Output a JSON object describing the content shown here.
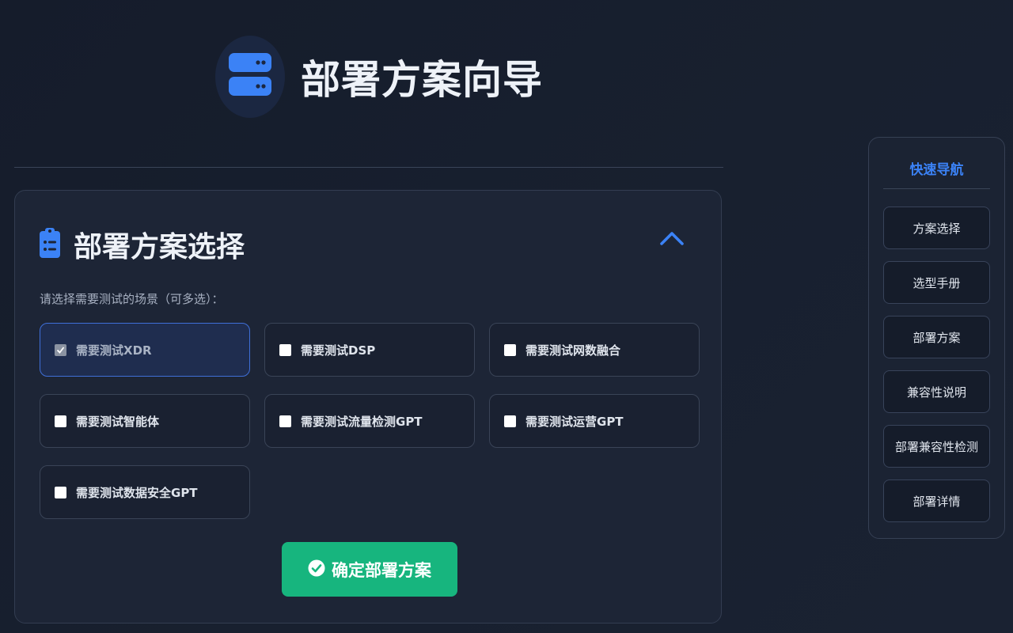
{
  "header": {
    "title": "部署方案向导",
    "logo_icon": "server-icon",
    "accent_color": "#3b82f6"
  },
  "panel": {
    "title": "部署方案选择",
    "title_icon": "clipboard-list-icon",
    "collapse_icon": "chevron-up-icon",
    "prompt": "请选择需要测试的场景（可多选）：",
    "options": [
      {
        "label": "需要测试XDR",
        "checked": true
      },
      {
        "label": "需要测试DSP",
        "checked": false
      },
      {
        "label": "需要测试网数融合",
        "checked": false
      },
      {
        "label": "需要测试智能体",
        "checked": false
      },
      {
        "label": "需要测试流量检测GPT",
        "checked": false
      },
      {
        "label": "需要测试运营GPT",
        "checked": false
      },
      {
        "label": "需要测试数据安全GPT",
        "checked": false
      }
    ],
    "confirm_label": "确定部署方案",
    "confirm_icon": "check-circle-icon",
    "confirm_color": "#17b57e"
  },
  "nav": {
    "title": "快速导航",
    "items": [
      {
        "label": "方案选择"
      },
      {
        "label": "选型手册"
      },
      {
        "label": "部署方案"
      },
      {
        "label": "兼容性说明"
      },
      {
        "label": "部署兼容性检测"
      },
      {
        "label": "部署详情"
      }
    ]
  }
}
